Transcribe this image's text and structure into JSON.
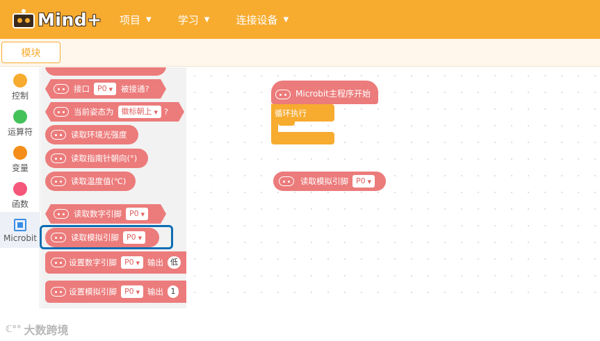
{
  "app": {
    "logo_text": "Mind+"
  },
  "menu": [
    {
      "label": "项目"
    },
    {
      "label": "学习"
    },
    {
      "label": "连接设备"
    }
  ],
  "tabs": {
    "blocks": "模块"
  },
  "categories": [
    {
      "label": "控制",
      "color": "#f7ab2f"
    },
    {
      "label": "运算符",
      "color": "#44c25a"
    },
    {
      "label": "变量",
      "color": "#f58d1a"
    },
    {
      "label": "函数",
      "color": "#f5577a"
    },
    {
      "label": "Microbit",
      "color": "#3a8ee6",
      "active": true
    }
  ],
  "flyout": {
    "pin_touched": {
      "text": "接口",
      "pin": "P0",
      "suffix": "被接通?"
    },
    "gesture": {
      "text": "当前姿态为",
      "option": "徽标朝上",
      "suffix": "?"
    },
    "light": "读取环境光强度",
    "compass": "读取指南针朝向(°)",
    "temperature": "读取温度值(℃)",
    "digital_read": {
      "text": "读取数字引脚",
      "pin": "P0"
    },
    "analog_read": {
      "text": "读取模拟引脚",
      "pin": "P0"
    },
    "digital_write": {
      "text": "设置数字引脚",
      "pin": "P0",
      "output": "输出",
      "value": "低"
    },
    "analog_write": {
      "text": "设置模拟引脚",
      "pin": "P0",
      "output": "输出",
      "value": "1"
    }
  },
  "workspace": {
    "main_program": "Microbit主程序开始",
    "forever": "循环执行",
    "analog_read": {
      "text": "读取模拟引脚",
      "pin": "P0"
    }
  },
  "watermark": {
    "mark": "ℂ°°",
    "text": "大数跨境"
  }
}
